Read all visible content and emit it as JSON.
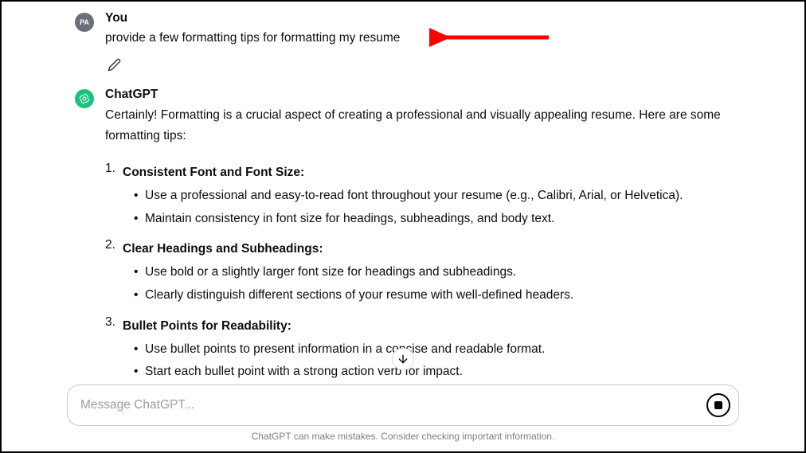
{
  "user": {
    "author": "You",
    "initials": "PA",
    "prompt": "provide a few formatting tips for formatting my resume"
  },
  "assistant": {
    "author": "ChatGPT",
    "intro": "Certainly! Formatting is a crucial aspect of creating a professional and visually appealing resume. Here are some formatting tips:",
    "tips": [
      {
        "title": "Consistent Font and Font Size:",
        "points": [
          "Use a professional and easy-to-read font throughout your resume (e.g., Calibri, Arial, or Helvetica).",
          "Maintain consistency in font size for headings, subheadings, and body text."
        ]
      },
      {
        "title": "Clear Headings and Subheadings:",
        "points": [
          "Use bold or a slightly larger font size for headings and subheadings.",
          "Clearly distinguish different sections of your resume with well-defined headers."
        ]
      },
      {
        "title": "Bullet Points for Readability:",
        "points": [
          "Use bullet points to present information in a concise and readable format.",
          "Start each bullet point with a strong action verb for impact."
        ]
      }
    ]
  },
  "input": {
    "placeholder": "Message ChatGPT..."
  },
  "disclaimer": "ChatGPT can make mistakes. Consider checking important information.",
  "colors": {
    "arrow": "#ff0000",
    "assistant_bg": "#19c37d"
  }
}
